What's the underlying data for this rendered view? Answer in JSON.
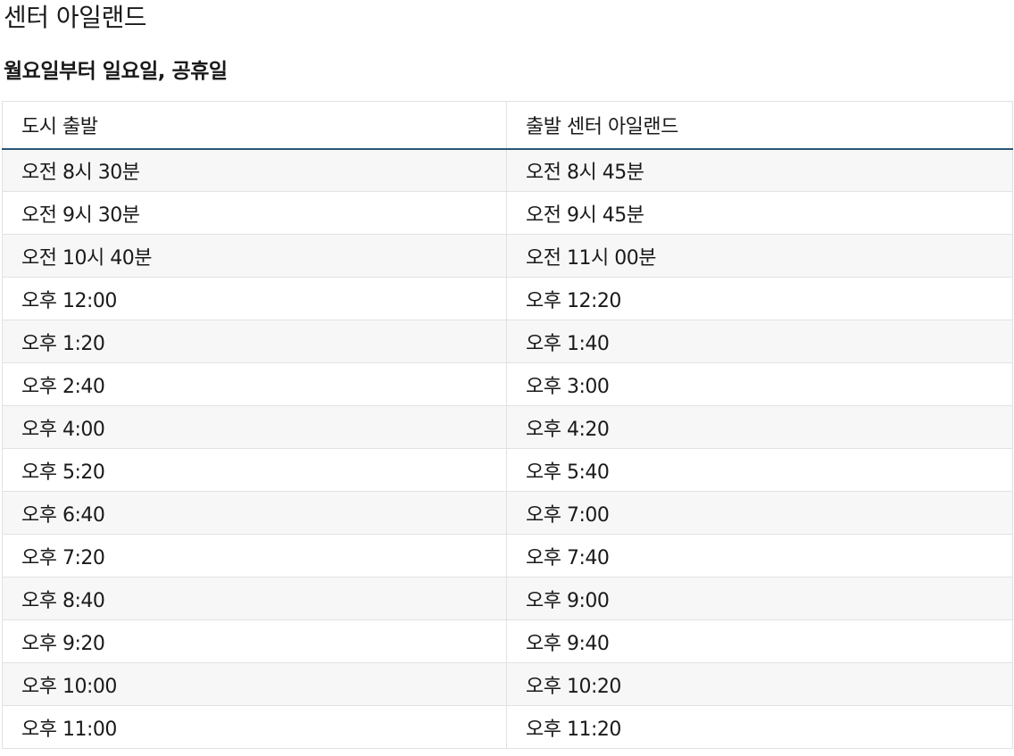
{
  "page": {
    "title": "센터 아일랜드",
    "subtitle": "월요일부터 일요일, 공휴일"
  },
  "table": {
    "headers": [
      "도시 출발",
      "출발 센터 아일랜드"
    ],
    "rows": [
      [
        "오전 8시 30분",
        "오전 8시 45분"
      ],
      [
        "오전 9시 30분",
        "오전 9시 45분"
      ],
      [
        "오전 10시 40분",
        "오전 11시 00분"
      ],
      [
        "오후 12:00",
        "오후 12:20"
      ],
      [
        "오후 1:20",
        "오후 1:40"
      ],
      [
        "오후 2:40",
        "오후 3:00"
      ],
      [
        "오후 4:00",
        "오후 4:20"
      ],
      [
        "오후 5:20",
        "오후 5:40"
      ],
      [
        "오후 6:40",
        "오후 7:00"
      ],
      [
        "오후 7:20",
        "오후 7:40"
      ],
      [
        "오후 8:40",
        "오후 9:00"
      ],
      [
        "오후 9:20",
        "오후 9:40"
      ],
      [
        "오후 10:00",
        "오후 10:20"
      ],
      [
        "오후 11:00",
        "오후 11:20"
      ]
    ]
  },
  "colors": {
    "header_rule": "#2b5575",
    "row_stripe": "#f7f7f7",
    "cell_border": "#e2e2e2"
  }
}
